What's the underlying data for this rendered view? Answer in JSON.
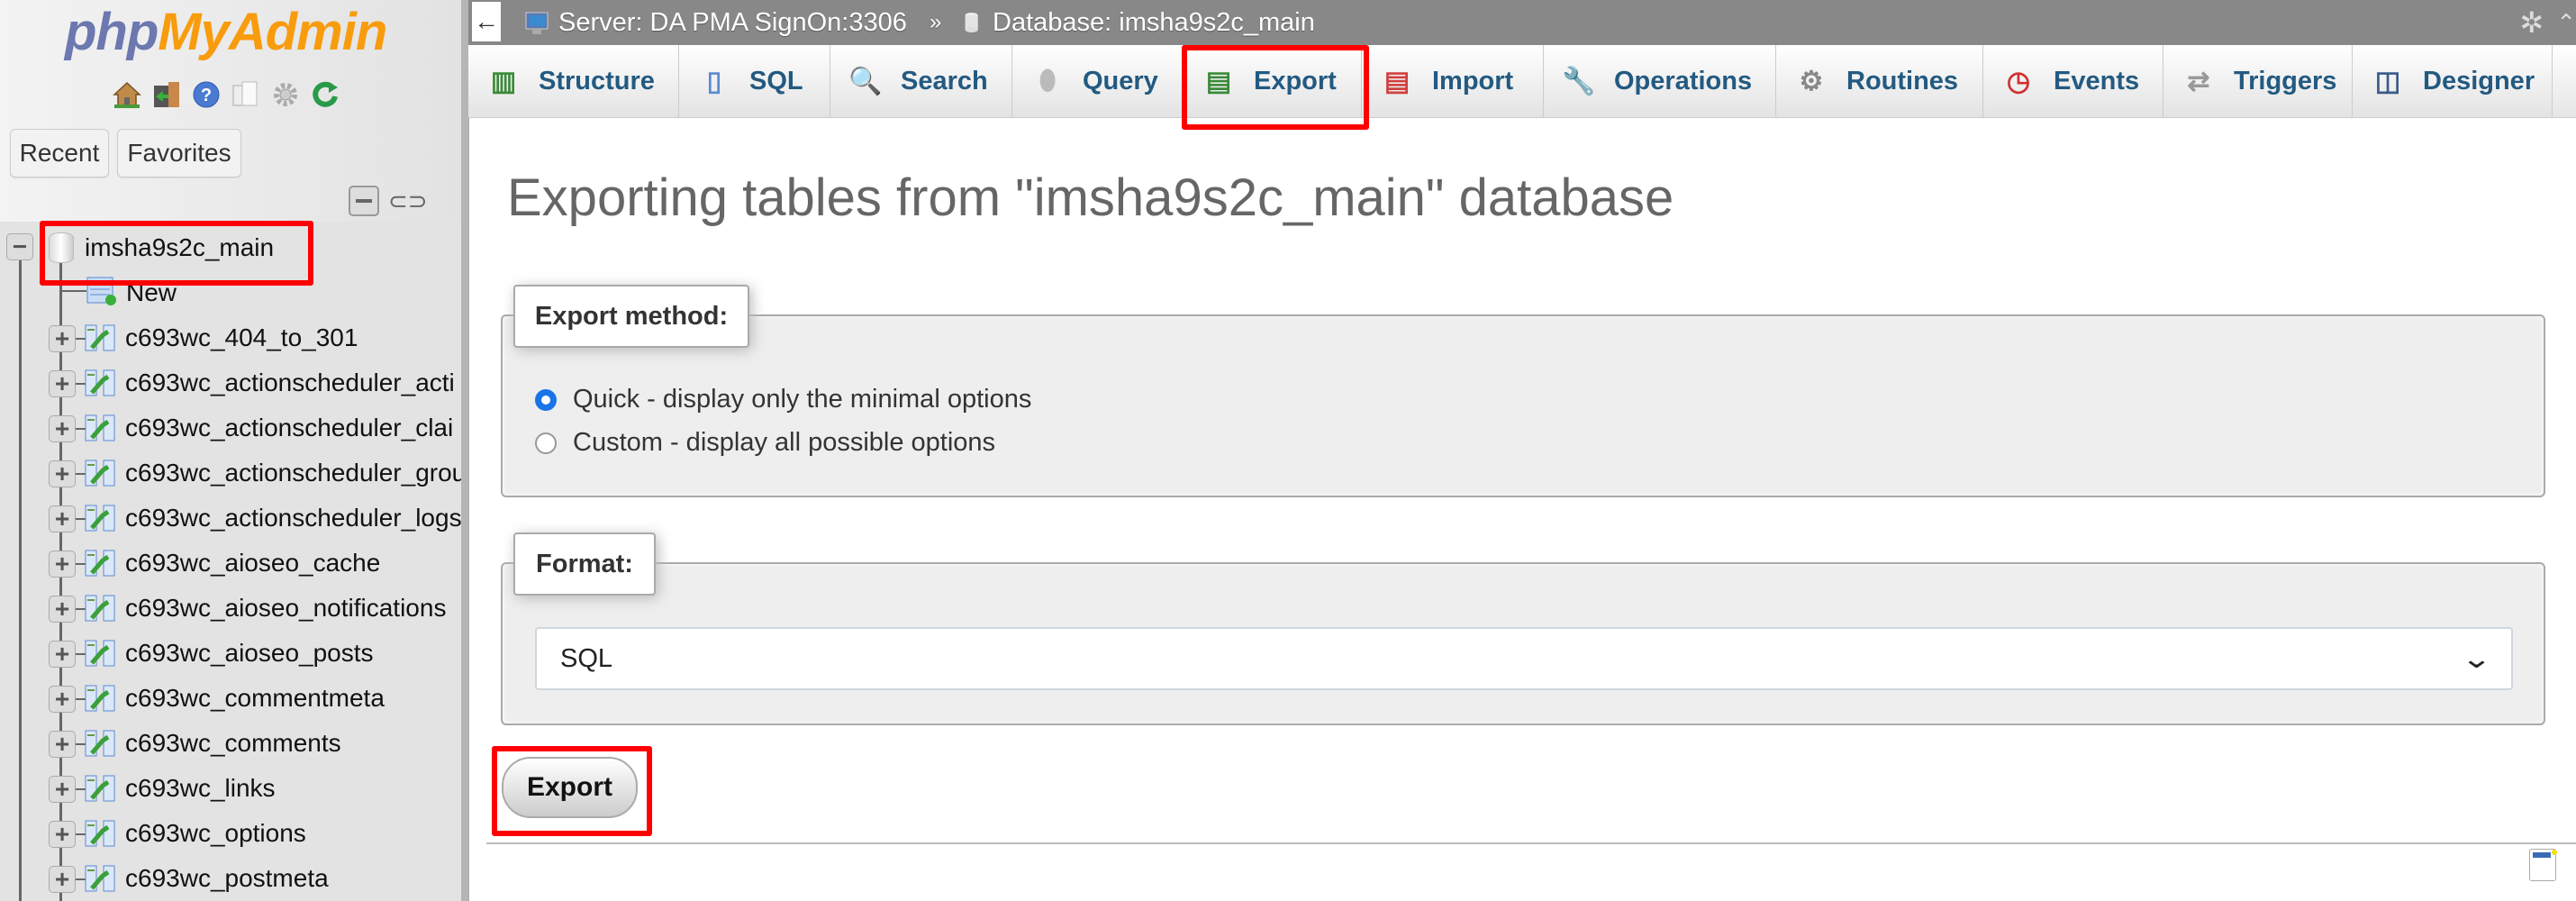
{
  "sidebar": {
    "logo": {
      "part1": "php",
      "part2": "MyAdmin"
    },
    "nav_icons": [
      "home-icon",
      "logout-icon",
      "help-icon",
      "docs-icon",
      "settings-icon",
      "reload-icon"
    ],
    "recent_label": "Recent",
    "favorites_label": "Favorites",
    "database": "imsha9s2c_main",
    "new_label": "New",
    "tables": [
      "c693wc_404_to_301",
      "c693wc_actionscheduler_acti",
      "c693wc_actionscheduler_clai",
      "c693wc_actionscheduler_grou",
      "c693wc_actionscheduler_logs",
      "c693wc_aioseo_cache",
      "c693wc_aioseo_notifications",
      "c693wc_aioseo_posts",
      "c693wc_commentmeta",
      "c693wc_comments",
      "c693wc_links",
      "c693wc_options",
      "c693wc_postmeta"
    ]
  },
  "topbar": {
    "back": "←",
    "server": "Server: DA PMA SignOn:3306",
    "separator": "»",
    "database": "Database: imsha9s2c_main"
  },
  "tabs": [
    {
      "label": "Structure",
      "icon": "structure-icon",
      "glyph": "▥"
    },
    {
      "label": "SQL",
      "icon": "sql-icon",
      "glyph": "▯"
    },
    {
      "label": "Search",
      "icon": "search-icon",
      "glyph": "🔍"
    },
    {
      "label": "Query",
      "icon": "query-icon",
      "glyph": "⬮"
    },
    {
      "label": "Export",
      "icon": "export-icon",
      "glyph": "▤"
    },
    {
      "label": "Import",
      "icon": "import-icon",
      "glyph": "▤"
    },
    {
      "label": "Operations",
      "icon": "wrench-icon",
      "glyph": "🔧"
    },
    {
      "label": "Routines",
      "icon": "routines-icon",
      "glyph": "⚙"
    },
    {
      "label": "Events",
      "icon": "clock-icon",
      "glyph": "◷"
    },
    {
      "label": "Triggers",
      "icon": "triggers-icon",
      "glyph": "⇄"
    },
    {
      "label": "Designer",
      "icon": "designer-icon",
      "glyph": "◫"
    }
  ],
  "main": {
    "title": "Exporting tables from \"imsha9s2c_main\" database",
    "export_method": {
      "legend": "Export method:",
      "options": [
        {
          "label": "Quick - display only the minimal options",
          "checked": true
        },
        {
          "label": "Custom - display all possible options",
          "checked": false
        }
      ]
    },
    "format": {
      "legend": "Format:",
      "selected": "SQL"
    },
    "export_button": "Export"
  },
  "colors": {
    "tab_text": "#235a81",
    "topbar_bg": "#888888",
    "highlight": "#ff0000",
    "radio_checked": "#1a73e8"
  }
}
